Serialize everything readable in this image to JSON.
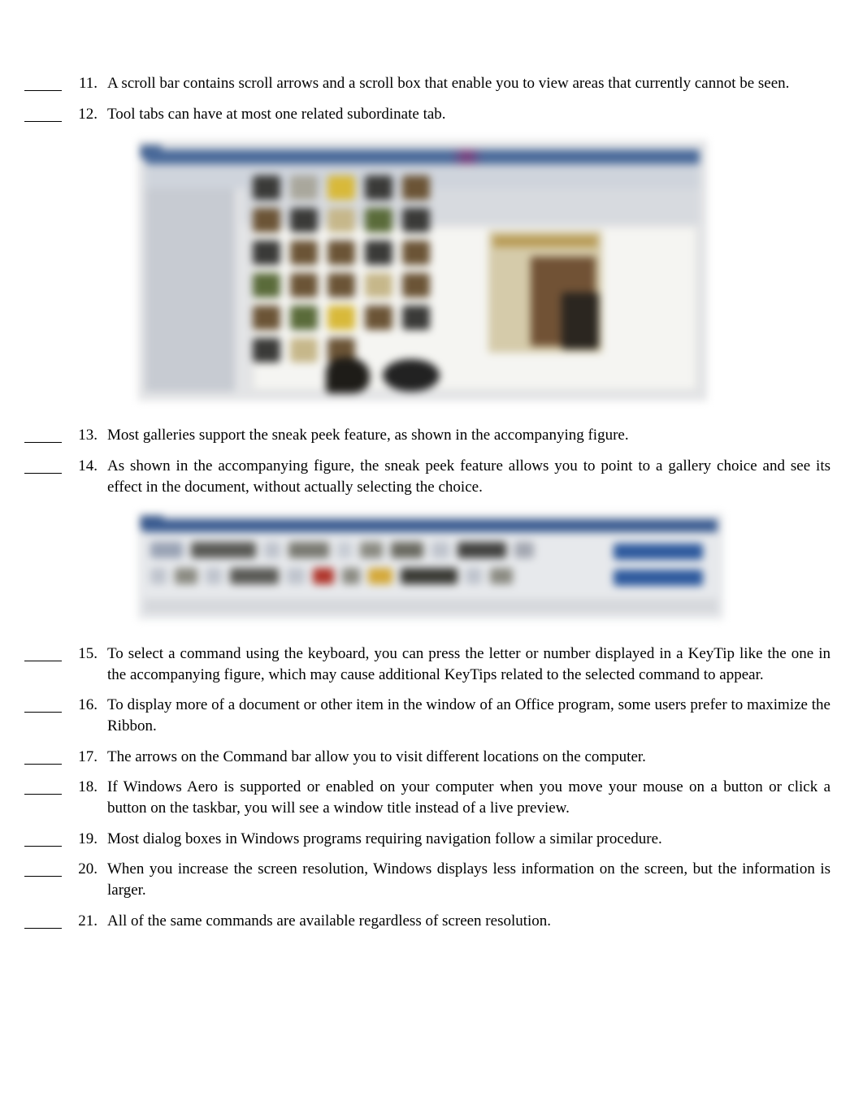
{
  "questions": [
    {
      "num": "11.",
      "text": "A scroll bar contains scroll arrows and a scroll box that enable you to view areas that currently cannot be seen."
    },
    {
      "num": "12.",
      "text": "Tool tabs can have at most one related subordinate tab."
    }
  ],
  "questions_mid": [
    {
      "num": "13.",
      "text": "Most galleries support the sneak peek feature, as shown in the accompanying figure."
    },
    {
      "num": "14.",
      "text": "As shown in the accompanying figure, the sneak peek feature allows you to point to a gallery choice and see its effect in the document, without actually selecting the choice."
    }
  ],
  "questions_after": [
    {
      "num": "15.",
      "text": "To select a command using the keyboard, you can press the letter or number displayed in a KeyTip like the one in the accompanying figure, which may cause additional KeyTips related to the selected command to appear."
    },
    {
      "num": "16.",
      "text": "To display more of a document or other item in the window of an Office program, some users prefer to maximize the Ribbon."
    },
    {
      "num": "17.",
      "text": "The arrows on the Command bar allow you to visit different locations on the computer."
    },
    {
      "num": "18.",
      "text": "If Windows Aero is supported or enabled on your computer when you move your mouse on a button or click a button on the taskbar, you will see a window title instead of a live preview."
    },
    {
      "num": "19.",
      "text": "Most dialog boxes in Windows programs requiring navigation follow a similar procedure."
    },
    {
      "num": "20.",
      "text": "When you increase the screen resolution, Windows displays less information on the screen, but the information is larger."
    },
    {
      "num": "21.",
      "text": "All of the same commands are available regardless of screen resolution."
    }
  ]
}
